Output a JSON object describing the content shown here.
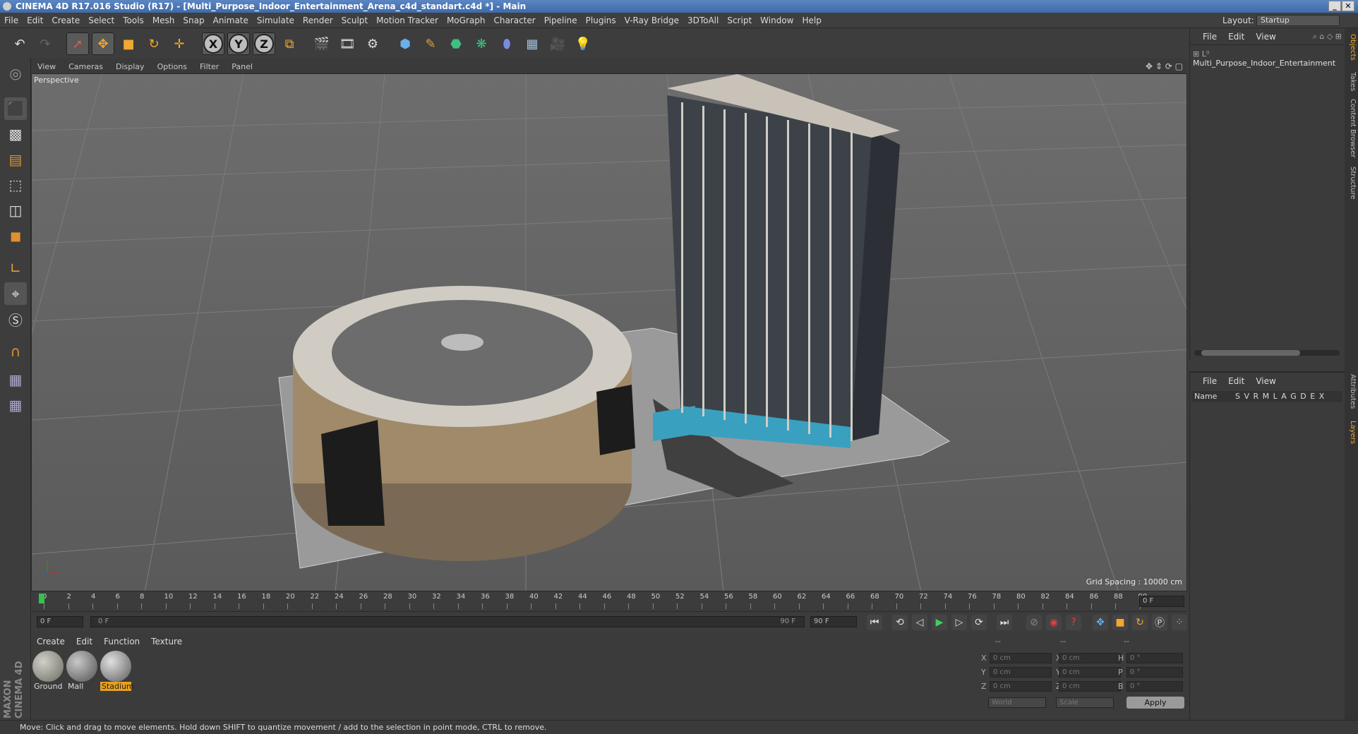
{
  "window": {
    "title": "CINEMA 4D R17.016 Studio (R17) - [Multi_Purpose_Indoor_Entertainment_Arena_c4d_standart.c4d *] - Main"
  },
  "menu": [
    "File",
    "Edit",
    "Create",
    "Select",
    "Tools",
    "Mesh",
    "Snap",
    "Animate",
    "Simulate",
    "Render",
    "Sculpt",
    "Motion Tracker",
    "MoGraph",
    "Character",
    "Pipeline",
    "Plugins",
    "V-Ray Bridge",
    "3DToAll",
    "Script",
    "Window",
    "Help"
  ],
  "layout": {
    "label": "Layout:",
    "value": "Startup"
  },
  "viewport": {
    "menu": [
      "View",
      "Cameras",
      "Display",
      "Options",
      "Filter",
      "Panel"
    ],
    "label": "Perspective",
    "grid_spacing": "Grid Spacing : 10000 cm"
  },
  "timeline": {
    "ticks": [
      "0",
      "2",
      "4",
      "6",
      "8",
      "10",
      "12",
      "14",
      "16",
      "18",
      "20",
      "22",
      "24",
      "26",
      "28",
      "30",
      "32",
      "34",
      "36",
      "38",
      "40",
      "42",
      "44",
      "46",
      "48",
      "50",
      "52",
      "54",
      "56",
      "58",
      "60",
      "62",
      "64",
      "66",
      "68",
      "70",
      "72",
      "74",
      "76",
      "78",
      "80",
      "82",
      "84",
      "86",
      "88",
      "90"
    ],
    "current": "0 F"
  },
  "anim": {
    "start": "0 F",
    "range_start": "0 F",
    "range_end": "90 F",
    "end": "90 F"
  },
  "materials": {
    "menu": [
      "Create",
      "Edit",
      "Function",
      "Texture"
    ],
    "items": [
      {
        "name": "Ground",
        "selected": false
      },
      {
        "name": "Mall",
        "selected": false
      },
      {
        "name": "Stadium",
        "selected": true
      }
    ]
  },
  "coords": {
    "headers": [
      "--",
      "--",
      "--"
    ],
    "rows": [
      {
        "a": "X",
        "av": "0 cm",
        "b": "X",
        "bv": "0 cm",
        "c": "H",
        "cv": "0 °"
      },
      {
        "a": "Y",
        "av": "0 cm",
        "b": "Y",
        "bv": "0 cm",
        "c": "P",
        "cv": "0 °"
      },
      {
        "a": "Z",
        "av": "0 cm",
        "b": "Z",
        "bv": "0 cm",
        "c": "B",
        "cv": "0 °"
      }
    ],
    "mode1": "World",
    "mode2": "Scale",
    "apply": "Apply"
  },
  "objects": {
    "menu": [
      "File",
      "Edit",
      "View"
    ],
    "items": [
      "Multi_Purpose_Indoor_Entertainment"
    ]
  },
  "layers": {
    "menu": [
      "File",
      "Edit",
      "View"
    ],
    "name_header": "Name",
    "flags": "S V R M L A G D E X"
  },
  "right_tabs": [
    "Objects",
    "Takes",
    "Content Browser",
    "Structure",
    "Attributes",
    "Layers"
  ],
  "brand": "MAXON CINEMA 4D",
  "status": "Move: Click and drag to move elements. Hold down SHIFT to quantize movement / add to the selection in point mode, CTRL to remove."
}
